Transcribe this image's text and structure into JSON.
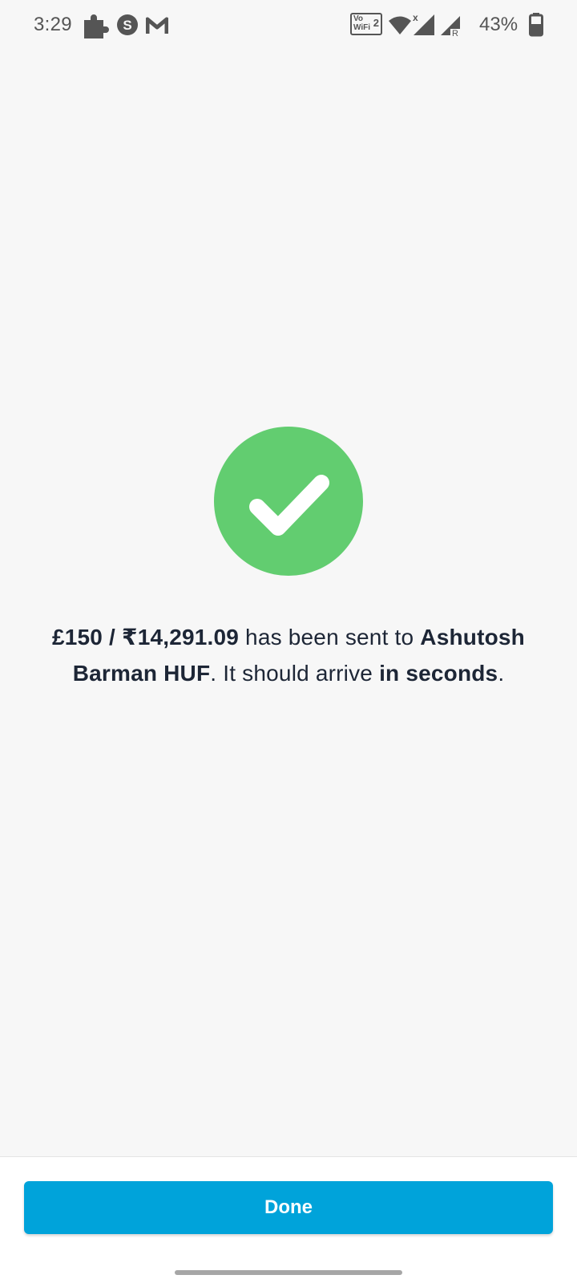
{
  "status_bar": {
    "time": "3:29",
    "vowifi_top": "Vo",
    "vowifi_bottom": "WiFi",
    "vowifi_sim": "2",
    "battery_percent": "43%",
    "icons": [
      "puzzle-icon",
      "s-app-icon",
      "m-app-icon",
      "vowifi-icon",
      "wifi-icon",
      "signal-icon",
      "signal-roaming-icon",
      "battery-icon"
    ]
  },
  "success": {
    "icon": "checkmark-icon",
    "color": "#62cd70",
    "amount": "£150 / ₹14,291.09",
    "sent_to_text": " has been sent to ",
    "recipient": "Ashutosh Barman HUF",
    "arrive_text": ". It should arrive ",
    "arrival_time": "in seconds",
    "end_text": "."
  },
  "footer": {
    "done_label": "Done",
    "button_color": "#00a3da"
  }
}
